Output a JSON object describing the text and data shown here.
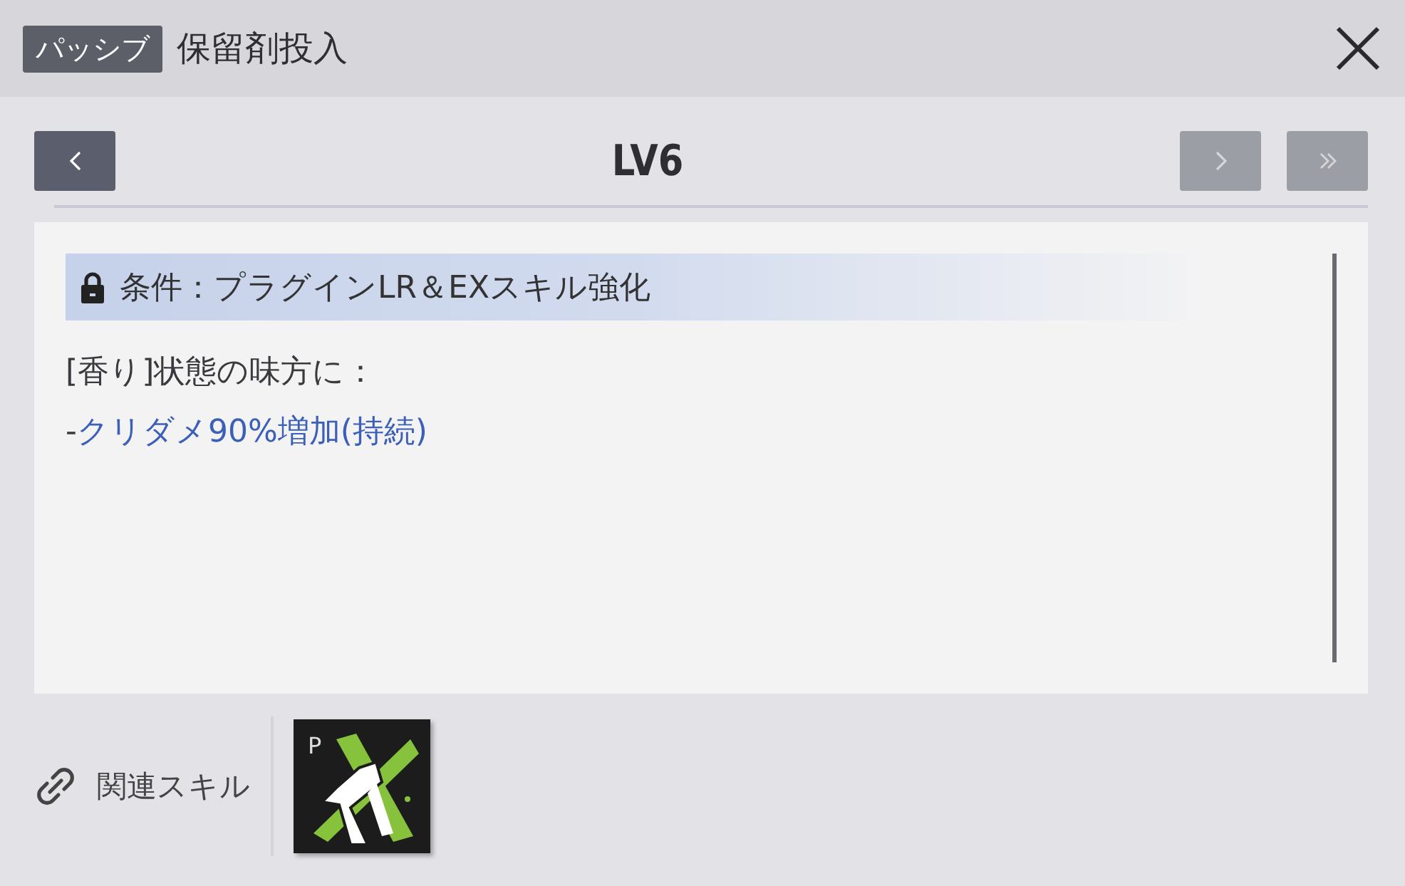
{
  "header": {
    "badge": "パッシブ",
    "title": "保留剤投入"
  },
  "level_nav": {
    "level": "LV6",
    "buttons": [
      {
        "kind": "prev",
        "disabled": false
      },
      {
        "kind": "next",
        "disabled": true
      },
      {
        "kind": "last",
        "disabled": true
      }
    ]
  },
  "condition": {
    "locked": true,
    "text": "条件：プラグインLR＆EXスキル強化"
  },
  "description": [
    {
      "kind": "plain",
      "text": "[香り]状態の味方に："
    },
    {
      "kind": "effect",
      "prefix": "-",
      "text": "クリダメ90%増加(持続)"
    }
  ],
  "related": {
    "label": "関連スキル",
    "skills": [
      {
        "badge": "P"
      }
    ]
  }
}
